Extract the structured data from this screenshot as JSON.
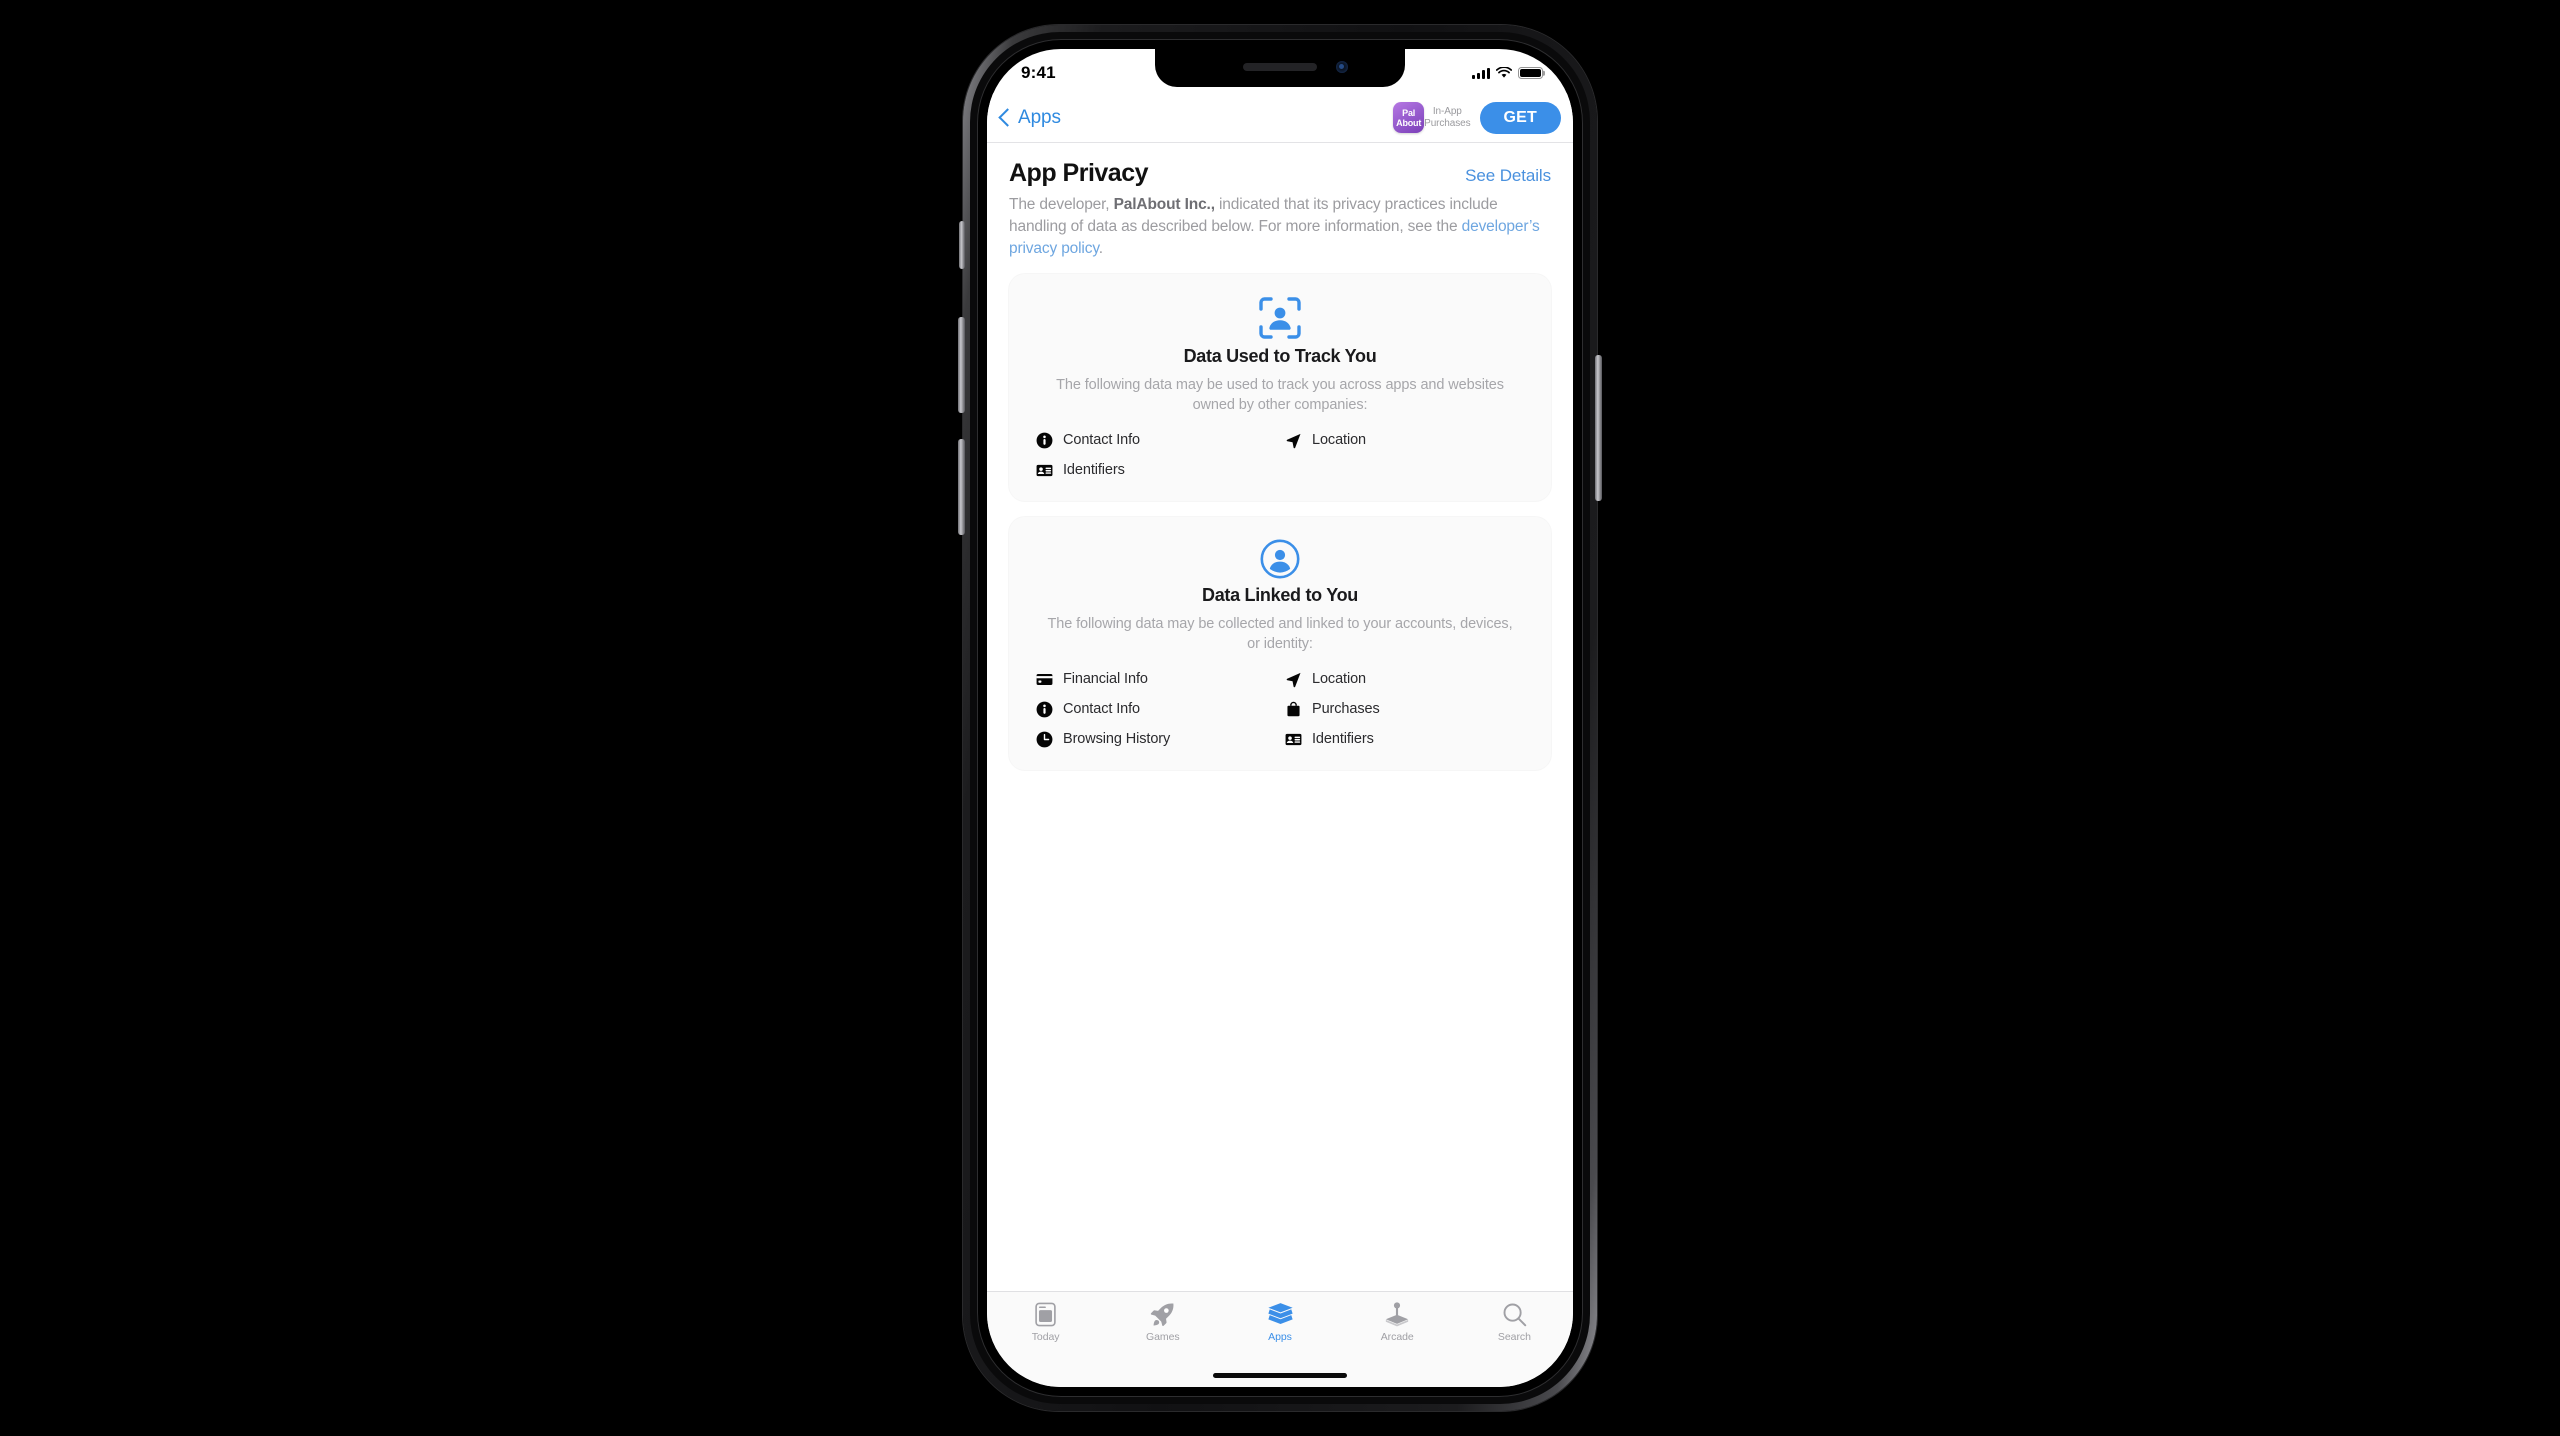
{
  "status_bar": {
    "time": "9:41",
    "signal_icon": "cellular-signal-icon",
    "wifi_icon": "wifi-icon",
    "battery_icon": "battery-icon"
  },
  "nav_bar": {
    "back_label": "Apps",
    "back_icon": "chevron-left-icon",
    "app_icon_line1": "Pal",
    "app_icon_line2": "About",
    "in_app_purchases_label": "In-App\nPurchases",
    "get_label": "GET"
  },
  "section": {
    "title": "App Privacy",
    "see_details_label": "See Details",
    "intro_prefix": "The developer, ",
    "intro_developer": "PalAbout Inc.,",
    "intro_middle": " indicated that its privacy practices include handling of data as described below. For more information, see the ",
    "intro_link": "developer’s privacy policy",
    "intro_suffix": "."
  },
  "cards": [
    {
      "icon": "track-person-viewfinder-icon",
      "title": "Data Used to Track You",
      "description": "The following data may be used to track you across apps and websites owned by other companies:",
      "items": [
        {
          "icon": "info-circle-icon",
          "label": "Contact Info"
        },
        {
          "icon": "location-arrow-icon",
          "label": "Location"
        },
        {
          "icon": "id-card-icon",
          "label": "Identifiers"
        }
      ]
    },
    {
      "icon": "person-circle-icon",
      "title": "Data Linked to You",
      "description": "The following data may be collected and linked to your accounts, devices, or identity:",
      "items": [
        {
          "icon": "credit-card-icon",
          "label": "Financial Info"
        },
        {
          "icon": "location-arrow-icon",
          "label": "Location"
        },
        {
          "icon": "info-circle-icon",
          "label": "Contact Info"
        },
        {
          "icon": "shopping-bag-icon",
          "label": "Purchases"
        },
        {
          "icon": "clock-icon",
          "label": "Browsing History"
        },
        {
          "icon": "id-card-icon",
          "label": "Identifiers"
        }
      ]
    }
  ],
  "tab_bar": {
    "tabs": [
      {
        "label": "Today",
        "icon": "today-newspaper-icon",
        "active": false
      },
      {
        "label": "Games",
        "icon": "rocket-icon",
        "active": false
      },
      {
        "label": "Apps",
        "icon": "stacked-layers-icon",
        "active": true
      },
      {
        "label": "Arcade",
        "icon": "joystick-icon",
        "active": false
      },
      {
        "label": "Search",
        "icon": "magnifier-icon",
        "active": false
      }
    ]
  },
  "colors": {
    "accent_blue": "#3b8fe8",
    "link_blue": "#4a91de",
    "app_icon_purple": "#9a5fd0",
    "muted_gray": "#a6a6aa",
    "card_bg": "#fafafa",
    "stage_bg": "#000000"
  }
}
